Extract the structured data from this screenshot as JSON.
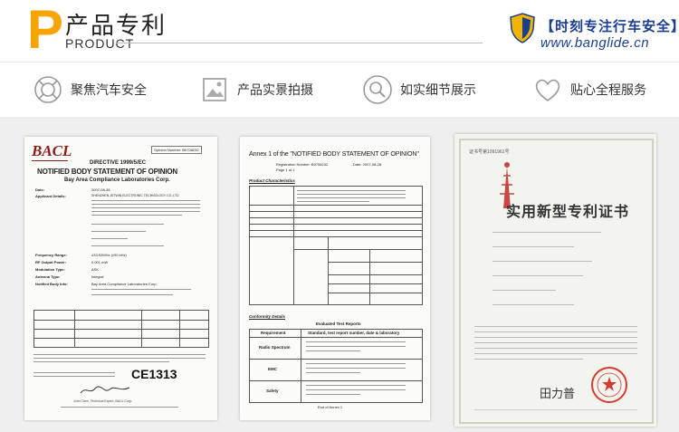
{
  "header": {
    "p_letter": "P",
    "title_cn": "产品专利",
    "title_en": "PRODUCT",
    "slogan": "【时刻专注行车安全】",
    "url": "www.banglide.cn"
  },
  "features": [
    {
      "icon": "lifebuoy-icon",
      "label": "聚焦汽车安全"
    },
    {
      "icon": "photo-icon",
      "label": "产品实景拍摄"
    },
    {
      "icon": "magnifier-icon",
      "label": "如实细节展示"
    },
    {
      "icon": "heart-icon",
      "label": "贴心全程服务"
    }
  ],
  "colors": {
    "accent": "#f5a400",
    "brand_blue": "#1a3f8f",
    "stamp_red": "#d43a2f"
  },
  "certificates": {
    "bacl": {
      "logo": "BACL",
      "opinion_no": "Opinion Number: B0708232",
      "directive": "DIRECTIVE 1999/5/EC",
      "heading": "NOTIFIED BODY STATEMENT OF OPINION",
      "company": "Bay Area Compliance Laboratories Corp.",
      "rows": [
        {
          "label": "Date:",
          "value": "2007-08-28"
        },
        {
          "label": "Applicant Details:",
          "value": "SHENZHEN JETWIN ELECTRONIC TECHNOLOGY CO.,LTD"
        },
        {
          "label": "Frequency Range:",
          "value": "433.92MHz (±50 kHz)"
        },
        {
          "label": "RF Output Power:",
          "value": "0.001 mW"
        },
        {
          "label": "Modulation Type:",
          "value": "ASK"
        },
        {
          "label": "Antenna Type:",
          "value": "Integral"
        },
        {
          "label": "Notified Body Info:",
          "value": "Bay Area Compliance Laboratories Corp."
        }
      ],
      "ce_mark": "CE1313",
      "signer": "John Chen, Technical Expert, BACL Corp."
    },
    "annex": {
      "heading": "Annex 1 of the \"NOTIFIED BODY STATEMENT OF OPINION\"",
      "reg": "Registration Number: B0708232",
      "date": "Date: 2007-08-28",
      "page": "Page 1 of 1",
      "sec1": "Product Characteristics",
      "sec2": "Conformity Details",
      "sec3": "Evaluated Test Reports",
      "col_req": "Requirement",
      "col_std": "Standard, test report number, date & laboratory",
      "requirements": [
        "Radio Spectrum",
        "EMC",
        "Safety"
      ],
      "footer": "End of Annex 1"
    },
    "patent": {
      "cert_no": "证书号第1091961号",
      "title": "实用新型专利证书",
      "sign": "田力普"
    }
  }
}
